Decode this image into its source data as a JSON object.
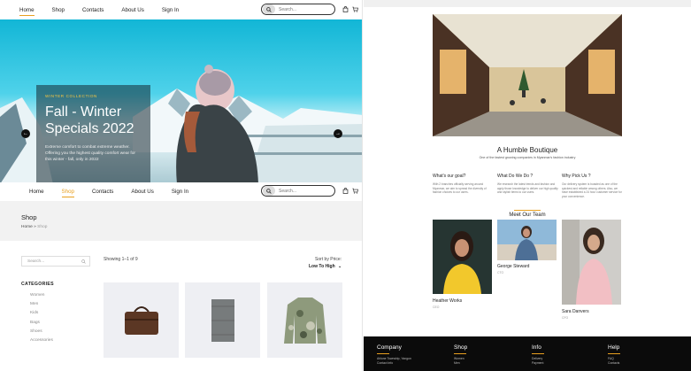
{
  "colors": {
    "accent": "#e8a020",
    "hero_sky": "#12b6d6",
    "footer_bg": "#0b0b0b"
  },
  "nav": {
    "links": [
      "Home",
      "Shop",
      "Contacts",
      "About Us",
      "Sign In"
    ],
    "search_placeholder": "Search...",
    "icons": [
      "search-icon",
      "bag-icon",
      "cart-icon"
    ]
  },
  "hero": {
    "tag": "WINTER COLLECTION",
    "title": "Fall - Winter Specials 2022",
    "description": "Extreme comfort to combat extreme weather. Offering you the highest quality comfort wear for this winter - fall, only in 2022",
    "prev_icon": "arrow-left-icon",
    "next_icon": "arrow-right-icon"
  },
  "shop": {
    "title": "Shop",
    "breadcrumb_home": "Home",
    "breadcrumb_sep": "»",
    "breadcrumb_current": "Shop",
    "search_placeholder": "Search...",
    "categories_title": "CATEGORIES",
    "categories": [
      "Women",
      "Men",
      "Kids",
      "Bags",
      "Shoes",
      "Accessories"
    ],
    "showing": "Showing 1–1 of 9",
    "sort_label": "Sort by Price:",
    "sort_value": "Low To High",
    "products": [
      "leather-bag",
      "grey-scarf",
      "camo-jacket"
    ]
  },
  "about": {
    "title": "A Humble Boutique",
    "subtitle": "One of the fastest growing companies in Myanmar's fashion industry",
    "columns": [
      {
        "title": "What's our goal?",
        "text": "With 2 branches officially serving around Myanmar, we aim to spread the diversity of fashion choices to our users."
      },
      {
        "title": "What Do We Do ?",
        "text": "We research the latest trends and fashion and apply those knowledge to deliver our high quality and stylish items to our users."
      },
      {
        "title": "Why Pick Us ?",
        "text": "Our delivery system is boasted as one of the quickest and reliable among others. Also, we have established a 24 hour customer service for your convenience."
      }
    ],
    "team_title": "Meet Our Team",
    "members": [
      {
        "name": "Heather Works",
        "role": "CEO"
      },
      {
        "name": "George Steward",
        "role": "CTO"
      },
      {
        "name": "Sara Danvers",
        "role": "CFO"
      }
    ]
  },
  "footer": {
    "columns": [
      {
        "title": "Company",
        "items": [
          "Ahlone Township, Yangon",
          "Contact info"
        ]
      },
      {
        "title": "Shop",
        "items": [
          "Women",
          "Men"
        ]
      },
      {
        "title": "Info",
        "items": [
          "Delivery",
          "Payment"
        ]
      },
      {
        "title": "Help",
        "items": [
          "FAQ",
          "Contacts"
        ]
      }
    ]
  }
}
